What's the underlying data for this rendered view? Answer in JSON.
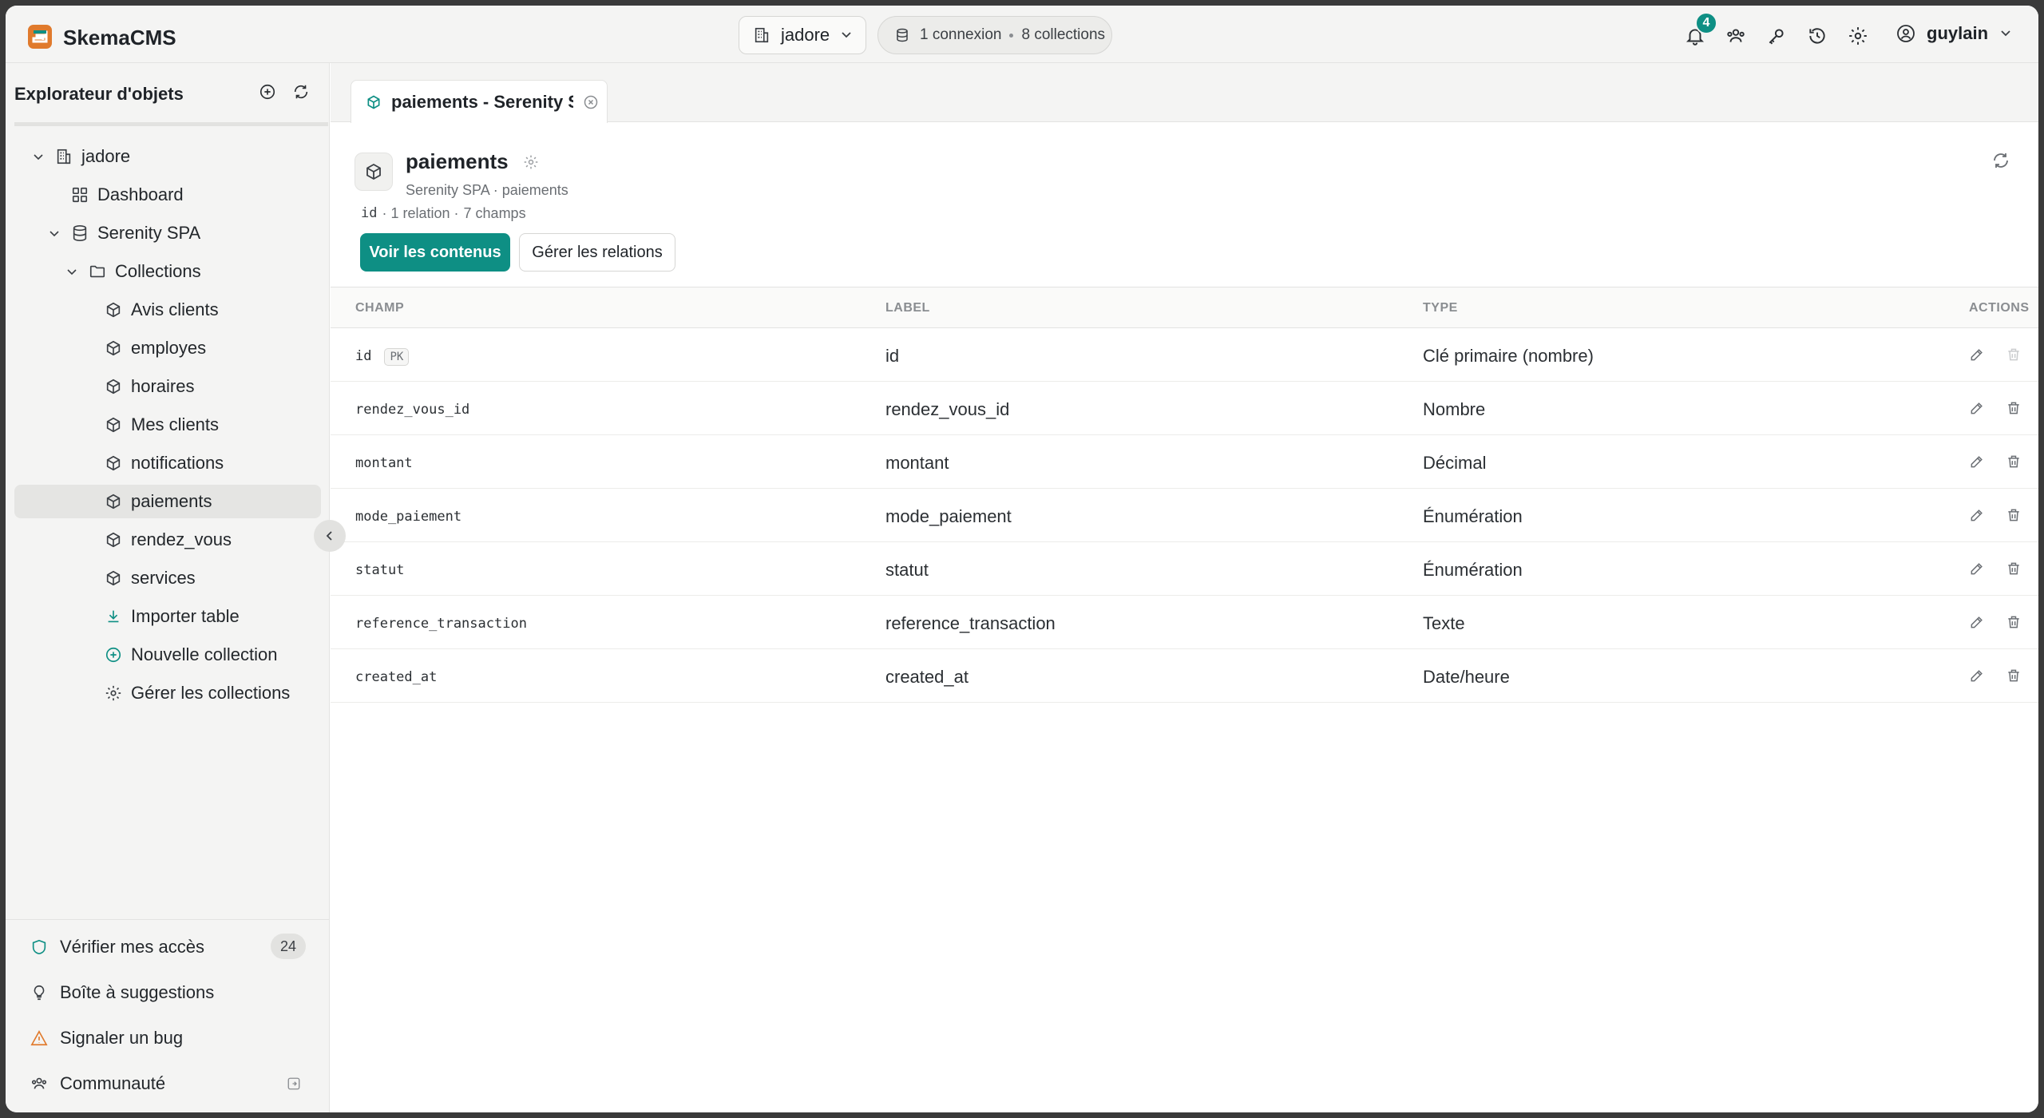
{
  "app": {
    "title": "SkemaCMS"
  },
  "topbar": {
    "workspace": "jadore",
    "connections_label": "1 connexion",
    "collections_label": "8 collections",
    "notifications_count": "4",
    "user_name": "guylain",
    "icons": [
      "bell-icon",
      "users-icon",
      "key-icon",
      "history-icon",
      "settings-icon",
      "user-circle-icon"
    ]
  },
  "sidebar": {
    "title": "Explorateur d'objets",
    "tree": {
      "root": "jadore",
      "dashboard": "Dashboard",
      "database": "Serenity SPA",
      "collections_folder": "Collections",
      "collections": [
        "Avis clients",
        "employes",
        "horaires",
        "Mes clients",
        "notifications",
        "paiements",
        "rendez_vous",
        "services"
      ],
      "active_collection": "paiements",
      "import": "Importer table",
      "new_collection": "Nouvelle collection",
      "manage": "Gérer les collections"
    },
    "bottom": {
      "access": "Vérifier mes accès",
      "access_count": "24",
      "suggestions": "Boîte à suggestions",
      "bug": "Signaler un bug",
      "community": "Communauté"
    },
    "colors": {
      "accent": "#0e8f84",
      "warning": "#e07a2c"
    }
  },
  "main": {
    "tab_label": "paiements - Serenity SPA",
    "collection": {
      "name": "paiements",
      "subtitle": "Serenity SPA · paiements",
      "meta_key": "id",
      "meta_relations": "· 1 relation ·",
      "meta_fields": "7 champs"
    },
    "buttons": {
      "view_contents": "Voir les contenus",
      "manage_relations": "Gérer les relations"
    },
    "table": {
      "headers": {
        "field": "CHAMP",
        "label": "LABEL",
        "type": "TYPE",
        "actions": "ACTIONS"
      },
      "pk_badge": "PK",
      "rows": [
        {
          "field": "id",
          "label": "id",
          "type": "Clé primaire (nombre)"
        },
        {
          "field": "rendez_vous_id",
          "label": "rendez_vous_id",
          "type": "Nombre"
        },
        {
          "field": "montant",
          "label": "montant",
          "type": "Décimal"
        },
        {
          "field": "mode_paiement",
          "label": "mode_paiement",
          "type": "Énumération"
        },
        {
          "field": "statut",
          "label": "statut",
          "type": "Énumération"
        },
        {
          "field": "reference_transaction",
          "label": "reference_transaction",
          "type": "Texte"
        },
        {
          "field": "created_at",
          "label": "created_at",
          "type": "Date/heure"
        }
      ]
    }
  }
}
